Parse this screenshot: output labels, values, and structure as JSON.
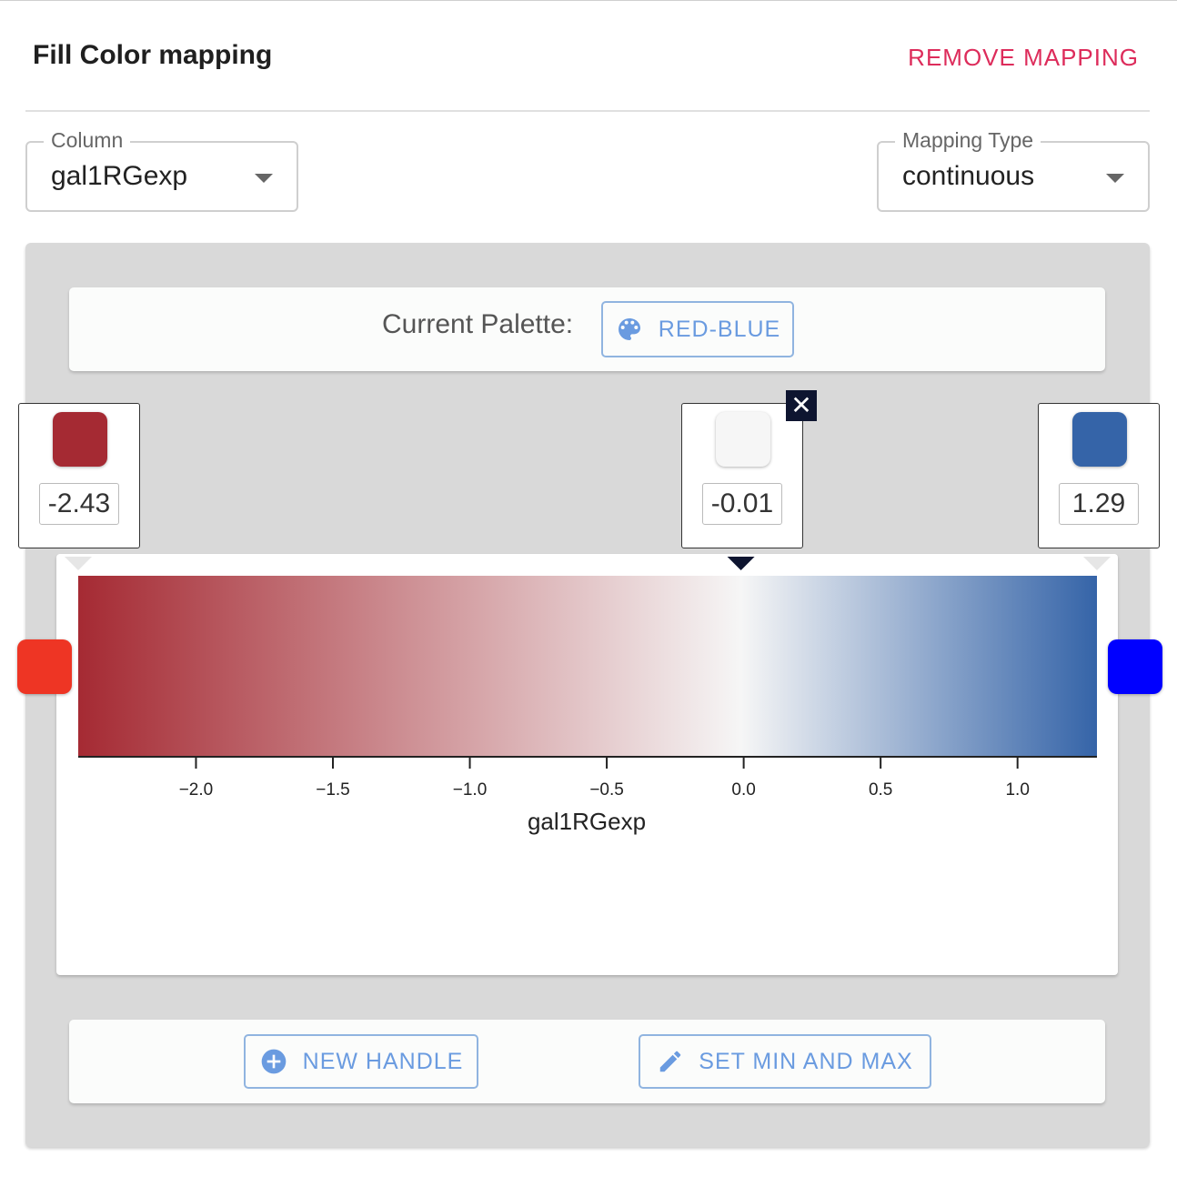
{
  "header": {
    "title": "Fill Color mapping",
    "remove_label": "REMOVE MAPPING"
  },
  "column_field": {
    "legend": "Column",
    "value": "gal1RGexp"
  },
  "type_field": {
    "legend": "Mapping Type",
    "value": "continuous"
  },
  "palette": {
    "label": "Current Palette:",
    "button_label": "RED-BLUE",
    "icon": "palette-icon"
  },
  "handles": [
    {
      "value": "-2.43",
      "color": "#a52a33"
    },
    {
      "value": "-0.01",
      "color": "#f6f6f6"
    },
    {
      "value": "1.29",
      "color": "#3564a8"
    }
  ],
  "close_symbol": "✕",
  "ends": {
    "left_color": "#ee3524",
    "right_color": "#0000ff"
  },
  "chart_data": {
    "type": "heatmap",
    "xlabel": "gal1RGexp",
    "xlim": [
      -2.43,
      1.29
    ],
    "ticks": [
      "−2.0",
      "−1.5",
      "−1.0",
      "−0.5",
      "0.0",
      "0.5",
      "1.0"
    ],
    "tick_values": [
      -2.0,
      -1.5,
      -1.0,
      -0.5,
      0.0,
      0.5,
      1.0
    ],
    "stops": [
      {
        "value": -2.43,
        "color": "#a52a33"
      },
      {
        "value": -0.01,
        "color": "#f6f6f6"
      },
      {
        "value": 1.29,
        "color": "#3564a8"
      }
    ]
  },
  "footer": {
    "new_handle_label": "NEW HANDLE",
    "set_minmax_label": "SET MIN AND MAX"
  }
}
